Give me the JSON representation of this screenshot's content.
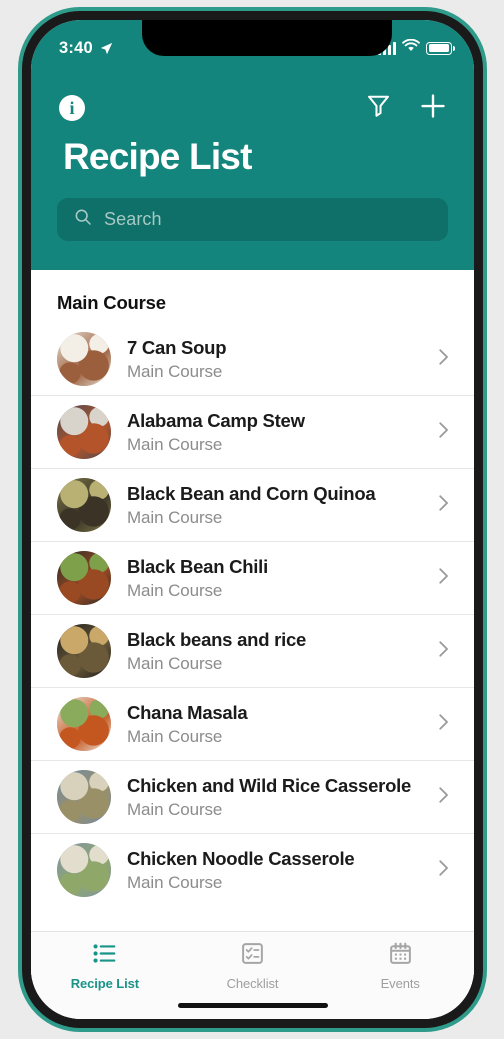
{
  "status_bar": {
    "time": "3:40",
    "location_icon": "location-arrow-icon",
    "signal_icon": "cellular-signal-icon",
    "wifi_icon": "wifi-icon",
    "battery_icon": "battery-full-icon"
  },
  "nav": {
    "info_label": "i",
    "info_icon": "info-icon",
    "filter_icon": "filter-funnel-icon",
    "add_icon": "plus-icon"
  },
  "header": {
    "title": "Recipe List"
  },
  "search": {
    "placeholder": "Search",
    "value": "",
    "icon": "search-icon"
  },
  "list": {
    "section_title": "Main Course",
    "chevron_icon": "chevron-right-icon",
    "items": [
      {
        "title": "7 Can Soup",
        "subtitle": "Main Course",
        "thumb": "recipe-thumbnail-7-can-soup",
        "c1": "#e8e2d8",
        "c2": "#9c5f3d",
        "c3": "#f3efe7"
      },
      {
        "title": "Alabama Camp Stew",
        "subtitle": "Main Course",
        "thumb": "recipe-thumbnail-alabama-camp-stew",
        "c1": "#4a4a52",
        "c2": "#b4542a",
        "c3": "#d8d4cc"
      },
      {
        "title": "Black Bean and Corn Quinoa",
        "subtitle": "Main Course",
        "thumb": "recipe-thumbnail-black-bean-corn-quinoa",
        "c1": "#7e7a4a",
        "c2": "#3a3326",
        "c3": "#b9b074"
      },
      {
        "title": "Black Bean Chili",
        "subtitle": "Main Course",
        "thumb": "recipe-thumbnail-black-bean-chili",
        "c1": "#2a2a2a",
        "c2": "#9a4a22",
        "c3": "#7fa04a"
      },
      {
        "title": "Black beans and rice",
        "subtitle": "Main Course",
        "thumb": "recipe-thumbnail-black-beans-and-rice",
        "c1": "#1c1c1c",
        "c2": "#6b5a3a",
        "c3": "#caa86a"
      },
      {
        "title": "Chana Masala",
        "subtitle": "Main Course",
        "thumb": "recipe-thumbnail-chana-masala",
        "c1": "#efe9e2",
        "c2": "#c4561f",
        "c3": "#8aab5c"
      },
      {
        "title": "Chicken and Wild Rice Casserole",
        "subtitle": "Main Course",
        "thumb": "recipe-thumbnail-chicken-wild-rice-casserole",
        "c1": "#6f8aa8",
        "c2": "#9a9068",
        "c3": "#d8d2bc"
      },
      {
        "title": "Chicken Noodle Casserole",
        "subtitle": "Main Course",
        "thumb": "recipe-thumbnail-chicken-noodle-casserole",
        "c1": "#7f93ab",
        "c2": "#8fa86a",
        "c3": "#e3ddcd"
      }
    ]
  },
  "tabs": [
    {
      "label": "Recipe List",
      "icon": "bulleted-list-icon",
      "active": true
    },
    {
      "label": "Checklist",
      "icon": "checklist-icon",
      "active": false
    },
    {
      "label": "Events",
      "icon": "calendar-icon",
      "active": false
    }
  ],
  "colors": {
    "brand_teal": "#13857c",
    "search_field": "#0e7068",
    "tab_active": "#1a9488",
    "tab_inactive": "#9e9e9e",
    "subtitle_gray": "#8c8c8c",
    "frame_teal": "#2f9b8b",
    "page_background": "#ebebeb"
  }
}
